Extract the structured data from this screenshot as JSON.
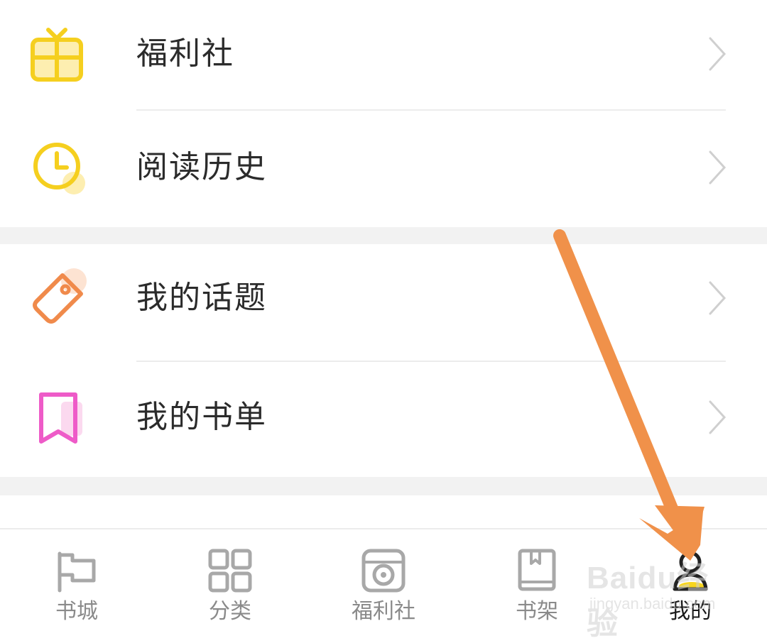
{
  "menu": {
    "items": [
      {
        "label": "福利社",
        "icon": "gift-icon"
      },
      {
        "label": "阅读历史",
        "icon": "clock-icon"
      },
      {
        "label": "我的话题",
        "icon": "tag-icon"
      },
      {
        "label": "我的书单",
        "icon": "bookmark-icon"
      }
    ]
  },
  "bottom_nav": {
    "tabs": [
      {
        "label": "书城",
        "icon": "flag-icon",
        "active": false
      },
      {
        "label": "分类",
        "icon": "grid-icon",
        "active": false
      },
      {
        "label": "福利社",
        "icon": "camera-icon",
        "active": false
      },
      {
        "label": "书架",
        "icon": "book-icon",
        "active": false
      },
      {
        "label": "我的",
        "icon": "user-icon",
        "active": true
      }
    ]
  },
  "watermark": {
    "line1": "Baidu经验",
    "line2": "jingyan.baidu.com"
  },
  "colors": {
    "gift": "#f5cf1f",
    "clock": "#f5cf1f",
    "tag": "#f08a4b",
    "bookmark": "#ee5bc8",
    "arrow": "#f0914a",
    "nav_inactive": "#a8a8a8",
    "nav_active": "#222222",
    "accent_yellow": "#f7d51f"
  }
}
